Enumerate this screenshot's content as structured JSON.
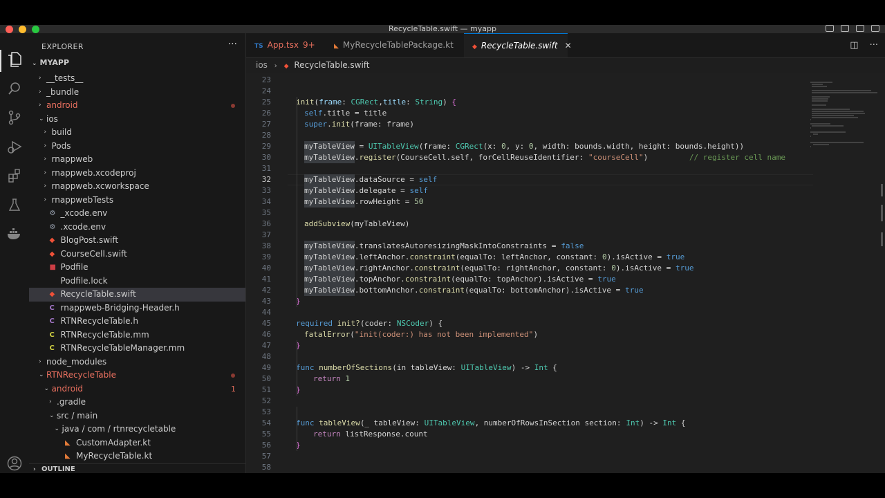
{
  "window": {
    "title": "RecycleTable.swift — myapp"
  },
  "activity_bar": {
    "icons": [
      "files-icon",
      "search-icon",
      "source-control-icon",
      "run-debug-icon",
      "extensions-icon",
      "testing-icon",
      "docker-icon",
      "account-icon"
    ]
  },
  "explorer": {
    "header": "EXPLORER",
    "more": "···",
    "root": "MYAPP",
    "outline_label": "OUTLINE",
    "items": [
      {
        "label": "__tests__",
        "kind": "folder",
        "depth": 1
      },
      {
        "label": "_bundle",
        "kind": "folder",
        "depth": 1
      },
      {
        "label": "android",
        "kind": "folder",
        "depth": 1,
        "status": "red",
        "dot": true
      },
      {
        "label": "ios",
        "kind": "folder-open",
        "depth": 1
      },
      {
        "label": "build",
        "kind": "folder",
        "depth": 2
      },
      {
        "label": "Pods",
        "kind": "folder",
        "depth": 2
      },
      {
        "label": "rnappweb",
        "kind": "folder",
        "depth": 2
      },
      {
        "label": "rnappweb.xcodeproj",
        "kind": "folder",
        "depth": 2
      },
      {
        "label": "rnappweb.xcworkspace",
        "kind": "folder",
        "depth": 2
      },
      {
        "label": "rnappwebTests",
        "kind": "folder",
        "depth": 2
      },
      {
        "label": "_xcode.env",
        "kind": "gear",
        "depth": 2
      },
      {
        "label": ".xcode.env",
        "kind": "gear",
        "depth": 2
      },
      {
        "label": "BlogPost.swift",
        "kind": "swift",
        "depth": 2
      },
      {
        "label": "CourseCell.swift",
        "kind": "swift",
        "depth": 2
      },
      {
        "label": "Podfile",
        "kind": "ruby",
        "depth": 2
      },
      {
        "label": "Podfile.lock",
        "kind": "text",
        "depth": 2
      },
      {
        "label": "RecycleTable.swift",
        "kind": "swift",
        "depth": 2,
        "selected": true
      },
      {
        "label": "rnappweb-Bridging-Header.h",
        "kind": "c",
        "depth": 2
      },
      {
        "label": "RTNRecycleTable.h",
        "kind": "c",
        "depth": 2
      },
      {
        "label": "RTNRecycleTable.mm",
        "kind": "cpp",
        "depth": 2
      },
      {
        "label": "RTNRecycleTableManager.mm",
        "kind": "cpp",
        "depth": 2
      },
      {
        "label": "node_modules",
        "kind": "folder",
        "depth": 1
      },
      {
        "label": "RTNRecycleTable",
        "kind": "folder-open",
        "depth": 1,
        "status": "red",
        "dot": true
      },
      {
        "label": "android",
        "kind": "folder-open",
        "depth": 2,
        "status": "red",
        "count": "1"
      },
      {
        "label": ".gradle",
        "kind": "folder",
        "depth": 3
      },
      {
        "label": "src / main",
        "kind": "folder-open",
        "depth": 3
      },
      {
        "label": "java / com / rtnrecycletable",
        "kind": "folder-open",
        "depth": 4
      },
      {
        "label": "CustomAdapter.kt",
        "kind": "kotlin",
        "depth": 5
      },
      {
        "label": "MyRecycleTable.kt",
        "kind": "kotlin",
        "depth": 5
      }
    ]
  },
  "tabs": [
    {
      "icon": "TS",
      "label": "App.tsx",
      "badge": "9+",
      "active": false
    },
    {
      "icon": "K",
      "label": "MyRecycleTablePackage.kt",
      "active": false
    },
    {
      "icon": "swift",
      "label": "RecycleTable.swift",
      "active": true,
      "close": "✕"
    }
  ],
  "breadcrumb": {
    "folder": "ios",
    "file": "RecycleTable.swift"
  },
  "editor": {
    "current_line": "32",
    "lines": [
      {
        "n": "23",
        "indent": 0,
        "tokens": []
      },
      {
        "n": "24",
        "indent": 0,
        "tokens": []
      },
      {
        "n": "25",
        "indent": 1,
        "tokens": [
          [
            "init",
            "#dcdcaa"
          ],
          [
            "(",
            ""
          ],
          [
            "frame",
            "#9cdcfe"
          ],
          [
            ": ",
            ""
          ],
          [
            "CGRect",
            "#4ec9b0"
          ],
          [
            ",",
            ""
          ],
          [
            "title",
            "#9cdcfe"
          ],
          [
            ": ",
            ""
          ],
          [
            "String",
            "#4ec9b0"
          ],
          [
            ") ",
            ""
          ],
          [
            "{",
            "#da70d6"
          ]
        ]
      },
      {
        "n": "26",
        "indent": 2,
        "tokens": [
          [
            "self",
            "#569cd6"
          ],
          [
            ".title = title",
            ""
          ]
        ]
      },
      {
        "n": "27",
        "indent": 2,
        "tokens": [
          [
            "super",
            "#569cd6"
          ],
          [
            ".",
            ""
          ],
          [
            "init",
            "#dcdcaa"
          ],
          [
            "(frame: frame)",
            ""
          ]
        ]
      },
      {
        "n": "28",
        "indent": 0,
        "tokens": []
      },
      {
        "n": "29",
        "indent": 2,
        "tokens": [
          [
            "myTableView",
            ""
          ],
          [
            " = ",
            ""
          ],
          [
            "UITableView",
            "#4ec9b0"
          ],
          [
            "(frame: ",
            ""
          ],
          [
            "CGRect",
            "#4ec9b0"
          ],
          [
            "(x: ",
            ""
          ],
          [
            "0",
            "#b5cea8"
          ],
          [
            ", y: ",
            ""
          ],
          [
            "0",
            "#b5cea8"
          ],
          [
            ", width: bounds.width, height: bounds.height))",
            ""
          ]
        ]
      },
      {
        "n": "30",
        "indent": 2,
        "tokens": [
          [
            "myTableView",
            ""
          ],
          [
            ".",
            ""
          ],
          [
            "register",
            "#dcdcaa"
          ],
          [
            "(CourseCell.self, forCellReuseIdentifier: ",
            ""
          ],
          [
            "\"courseCell\"",
            "#ce9178"
          ],
          [
            ")         ",
            ""
          ],
          [
            "// register cell name",
            "#6a9955"
          ]
        ]
      },
      {
        "n": "31",
        "indent": 0,
        "tokens": []
      },
      {
        "n": "32",
        "indent": 2,
        "tokens": [
          [
            "myTableView",
            ""
          ],
          [
            ".dataSource = ",
            ""
          ],
          [
            "self",
            "#569cd6"
          ]
        ]
      },
      {
        "n": "33",
        "indent": 2,
        "tokens": [
          [
            "myTableView",
            ""
          ],
          [
            ".delegate = ",
            ""
          ],
          [
            "self",
            "#569cd6"
          ]
        ]
      },
      {
        "n": "34",
        "indent": 2,
        "tokens": [
          [
            "myTableView",
            ""
          ],
          [
            ".rowHeight = ",
            ""
          ],
          [
            "50",
            "#b5cea8"
          ]
        ]
      },
      {
        "n": "35",
        "indent": 0,
        "tokens": []
      },
      {
        "n": "36",
        "indent": 2,
        "tokens": [
          [
            "addSubview",
            "#dcdcaa"
          ],
          [
            "(myTableView)",
            ""
          ]
        ]
      },
      {
        "n": "37",
        "indent": 0,
        "tokens": []
      },
      {
        "n": "38",
        "indent": 2,
        "tokens": [
          [
            "myTableView",
            ""
          ],
          [
            ".translatesAutoresizingMaskIntoConstraints = ",
            ""
          ],
          [
            "false",
            "#569cd6"
          ]
        ]
      },
      {
        "n": "39",
        "indent": 2,
        "tokens": [
          [
            "myTableView",
            ""
          ],
          [
            ".leftAnchor.",
            ""
          ],
          [
            "constraint",
            "#dcdcaa"
          ],
          [
            "(equalTo: leftAnchor, constant: ",
            ""
          ],
          [
            "0",
            "#b5cea8"
          ],
          [
            ").isActive = ",
            ""
          ],
          [
            "true",
            "#569cd6"
          ]
        ]
      },
      {
        "n": "40",
        "indent": 2,
        "tokens": [
          [
            "myTableView",
            ""
          ],
          [
            ".rightAnchor.",
            ""
          ],
          [
            "constraint",
            "#dcdcaa"
          ],
          [
            "(equalTo: rightAnchor, constant: ",
            ""
          ],
          [
            "0",
            "#b5cea8"
          ],
          [
            ").isActive = ",
            ""
          ],
          [
            "true",
            "#569cd6"
          ]
        ]
      },
      {
        "n": "41",
        "indent": 2,
        "tokens": [
          [
            "myTableView",
            ""
          ],
          [
            ".topAnchor.",
            ""
          ],
          [
            "constraint",
            "#dcdcaa"
          ],
          [
            "(equalTo: topAnchor).isActive = ",
            ""
          ],
          [
            "true",
            "#569cd6"
          ]
        ]
      },
      {
        "n": "42",
        "indent": 2,
        "tokens": [
          [
            "myTableView",
            ""
          ],
          [
            ".bottomAnchor.",
            ""
          ],
          [
            "constraint",
            "#dcdcaa"
          ],
          [
            "(equalTo: bottomAnchor).isActive = ",
            ""
          ],
          [
            "true",
            "#569cd6"
          ]
        ]
      },
      {
        "n": "43",
        "indent": 1,
        "tokens": [
          [
            "}",
            "#da70d6"
          ]
        ]
      },
      {
        "n": "44",
        "indent": 0,
        "tokens": []
      },
      {
        "n": "45",
        "indent": 1,
        "tokens": [
          [
            "required",
            "#569cd6"
          ],
          [
            " ",
            ""
          ],
          [
            "init?",
            "#dcdcaa"
          ],
          [
            "(coder: ",
            ""
          ],
          [
            "NSCoder",
            "#4ec9b0"
          ],
          [
            ") {",
            ""
          ]
        ]
      },
      {
        "n": "46",
        "indent": 2,
        "tokens": [
          [
            "fatalError",
            "#dcdcaa"
          ],
          [
            "(",
            ""
          ],
          [
            "\"init(coder:) has not been implemented\"",
            "#ce9178"
          ],
          [
            ")",
            ""
          ]
        ]
      },
      {
        "n": "47",
        "indent": 1,
        "tokens": [
          [
            "}",
            "#da70d6"
          ]
        ]
      },
      {
        "n": "48",
        "indent": 0,
        "tokens": []
      },
      {
        "n": "49",
        "indent": 1,
        "tokens": [
          [
            "func",
            "#569cd6"
          ],
          [
            " ",
            ""
          ],
          [
            "numberOfSections",
            "#dcdcaa"
          ],
          [
            "(in tableView: ",
            ""
          ],
          [
            "UITableView",
            "#4ec9b0"
          ],
          [
            ") -> ",
            ""
          ],
          [
            "Int",
            "#4ec9b0"
          ],
          [
            " {",
            ""
          ]
        ]
      },
      {
        "n": "50",
        "indent": 3,
        "tokens": [
          [
            "return",
            "#c586c0"
          ],
          [
            " ",
            ""
          ],
          [
            "1",
            "#b5cea8"
          ]
        ]
      },
      {
        "n": "51",
        "indent": 1,
        "tokens": [
          [
            "}",
            "#da70d6"
          ]
        ]
      },
      {
        "n": "52",
        "indent": 0,
        "tokens": []
      },
      {
        "n": "53",
        "indent": 0,
        "tokens": []
      },
      {
        "n": "54",
        "indent": 1,
        "tokens": [
          [
            "func",
            "#569cd6"
          ],
          [
            " ",
            ""
          ],
          [
            "tableView",
            "#dcdcaa"
          ],
          [
            "(_ tableView: ",
            ""
          ],
          [
            "UITableView",
            "#4ec9b0"
          ],
          [
            ", numberOfRowsInSection section: ",
            ""
          ],
          [
            "Int",
            "#4ec9b0"
          ],
          [
            ") -> ",
            ""
          ],
          [
            "Int",
            "#4ec9b0"
          ],
          [
            " {",
            ""
          ]
        ]
      },
      {
        "n": "55",
        "indent": 3,
        "tokens": [
          [
            "return",
            "#c586c0"
          ],
          [
            " listResponse.count",
            ""
          ]
        ]
      },
      {
        "n": "56",
        "indent": 1,
        "tokens": [
          [
            "}",
            "#da70d6"
          ]
        ]
      },
      {
        "n": "57",
        "indent": 0,
        "tokens": []
      },
      {
        "n": "58",
        "indent": 0,
        "tokens": []
      }
    ]
  },
  "colors": {
    "accent": "#0078d4",
    "swift": "#f05138",
    "git_modified": "#e9705f"
  }
}
